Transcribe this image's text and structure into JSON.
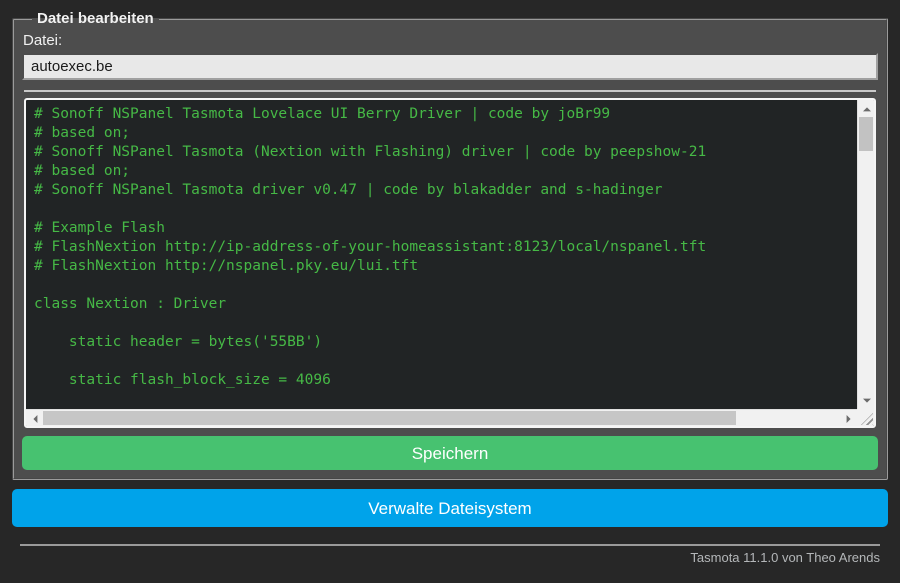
{
  "editor": {
    "legend": "Datei bearbeiten",
    "file_label": "Datei:",
    "file_input_value": "autoexec.be",
    "code_lines": [
      "# Sonoff NSPanel Tasmota Lovelace UI Berry Driver | code by joBr99",
      "# based on;",
      "# Sonoff NSPanel Tasmota (Nextion with Flashing) driver | code by peepshow-21",
      "# based on;",
      "# Sonoff NSPanel Tasmota driver v0.47 | code by blakadder and s-hadinger",
      "",
      "# Example Flash",
      "# FlashNextion http://ip-address-of-your-homeassistant:8123/local/nspanel.tft",
      "# FlashNextion http://nspanel.pky.eu/lui.tft",
      "",
      "class Nextion : Driver",
      "",
      "    static header = bytes('55BB')",
      "",
      "    static flash_block_size = 4096"
    ],
    "save_button": "Speichern"
  },
  "actions": {
    "manage_fs_button": "Verwalte Dateisystem"
  },
  "footer": {
    "text": "Tasmota 11.1.0 von Theo Arends"
  },
  "colors": {
    "page_bg": "#272727",
    "fieldset_bg": "#4d4d4d",
    "code_bg": "#212425",
    "code_text": "#46b946",
    "save_button_bg": "#47c270",
    "manage_fs_button_bg": "#00a3ea",
    "footer_text": "#b4b7b9"
  }
}
